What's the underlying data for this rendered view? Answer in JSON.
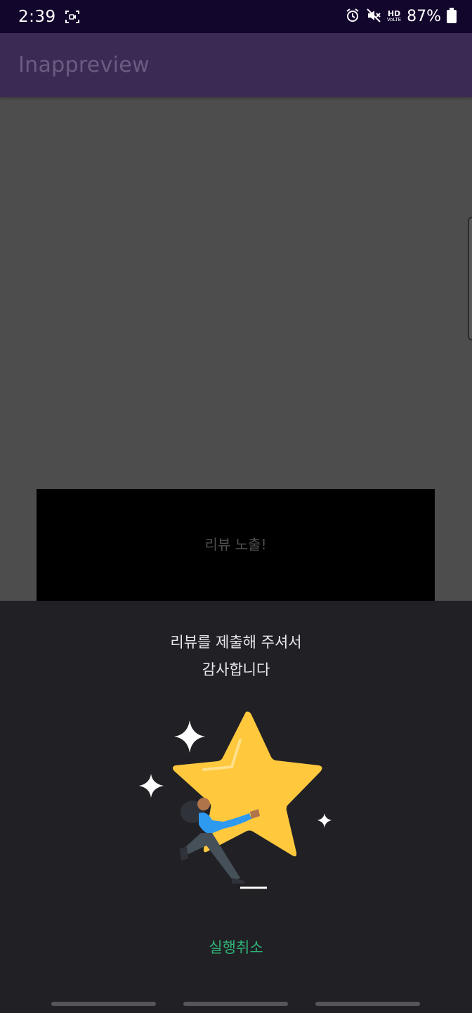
{
  "status_bar": {
    "time": "2:39",
    "hd_label": "HD",
    "hd_sub": "VoLTE",
    "battery": "87%",
    "icons": [
      "screen-record-icon",
      "alarm-icon",
      "mute-icon",
      "hd-voice-icon",
      "battery-icon"
    ]
  },
  "app_bar": {
    "title": "Inappreview"
  },
  "main": {
    "review_button_label": "리뷰 노출!"
  },
  "sheet": {
    "title_line1": "리뷰를 제출해 주셔서",
    "title_line2": "감사합니다",
    "undo_label": "실행취소",
    "accent_color": "#2fb377",
    "star_color": "#ffc83d"
  }
}
